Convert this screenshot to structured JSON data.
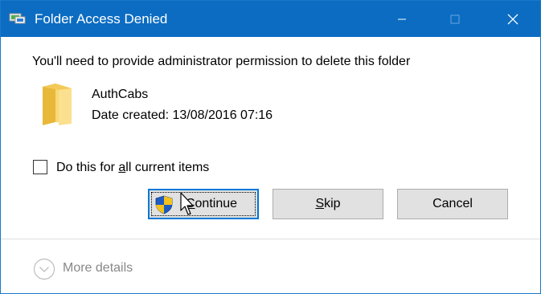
{
  "window": {
    "title": "Folder Access Denied",
    "accent": "#0b6cc2"
  },
  "dialog": {
    "message": "You'll need to provide administrator permission to delete this folder",
    "item": {
      "name": "AuthCabs",
      "date_label": "Date created:",
      "date_value": "13/08/2016 07:16",
      "icon": "folder-icon"
    },
    "checkbox": {
      "label_pre": "Do this for ",
      "label_accel": "a",
      "label_post": "ll current items",
      "checked": false
    }
  },
  "buttons": {
    "continue": {
      "accel": "C",
      "rest": "ontinue",
      "icon": "uac-shield-icon"
    },
    "skip": {
      "accel": "S",
      "rest": "kip"
    },
    "cancel": {
      "label": "Cancel"
    }
  },
  "footer": {
    "details_label": "More details",
    "icon": "chevron-down-circle-icon"
  }
}
